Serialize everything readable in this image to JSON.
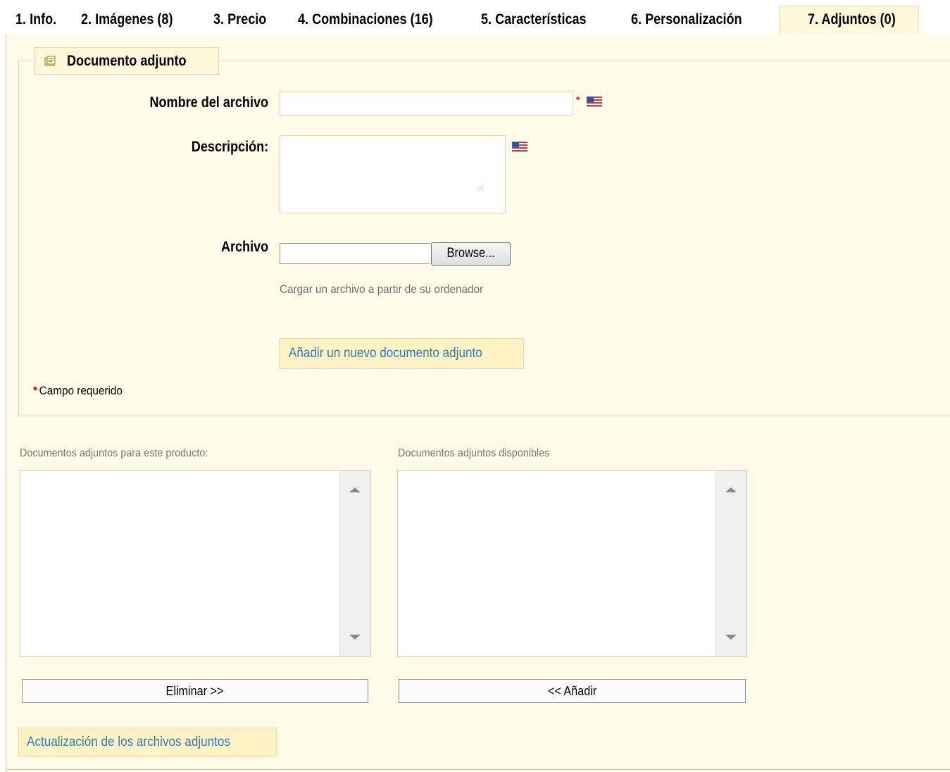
{
  "tabs": [
    {
      "label": "1. Info."
    },
    {
      "label": "2. Imágenes (8)"
    },
    {
      "label": "3. Precio"
    },
    {
      "label": "4. Combinaciones (16)"
    },
    {
      "label": "5. Características"
    },
    {
      "label": "6. Personalización"
    },
    {
      "label": "7. Adjuntos (0)",
      "active": true
    }
  ],
  "section": {
    "legend": "Documento adjunto",
    "legend_icon": "attachment-icon"
  },
  "form": {
    "filename_label": "Nombre del archivo",
    "filename_value": "",
    "required_marker": "*",
    "description_label": "Descripción:",
    "description_value": "",
    "file_label": "Archivo",
    "browse_label": "Browse...",
    "file_hint": "Cargar un archivo a partir de su ordenador",
    "add_button": "Añadir un nuevo documento adjunto",
    "required_note": "Campo requerido",
    "language_flag_icon": "us-flag-icon"
  },
  "lists": {
    "product_title": "Documentos adjuntos para este producto:",
    "available_title": "Documentos adjuntos disponibles",
    "product_items": [],
    "available_items": [],
    "remove_button": "Eliminar >>",
    "add_button": "<< Añadir"
  },
  "update_button": "Actualización de los archivos adjuntos",
  "colors": {
    "panel_bg": "#fffbe8",
    "active_tab_bg": "#fdf8da",
    "button_bg": "#fdf2c3",
    "link_blue": "#2e7dbb",
    "required_red": "#ee0000"
  }
}
